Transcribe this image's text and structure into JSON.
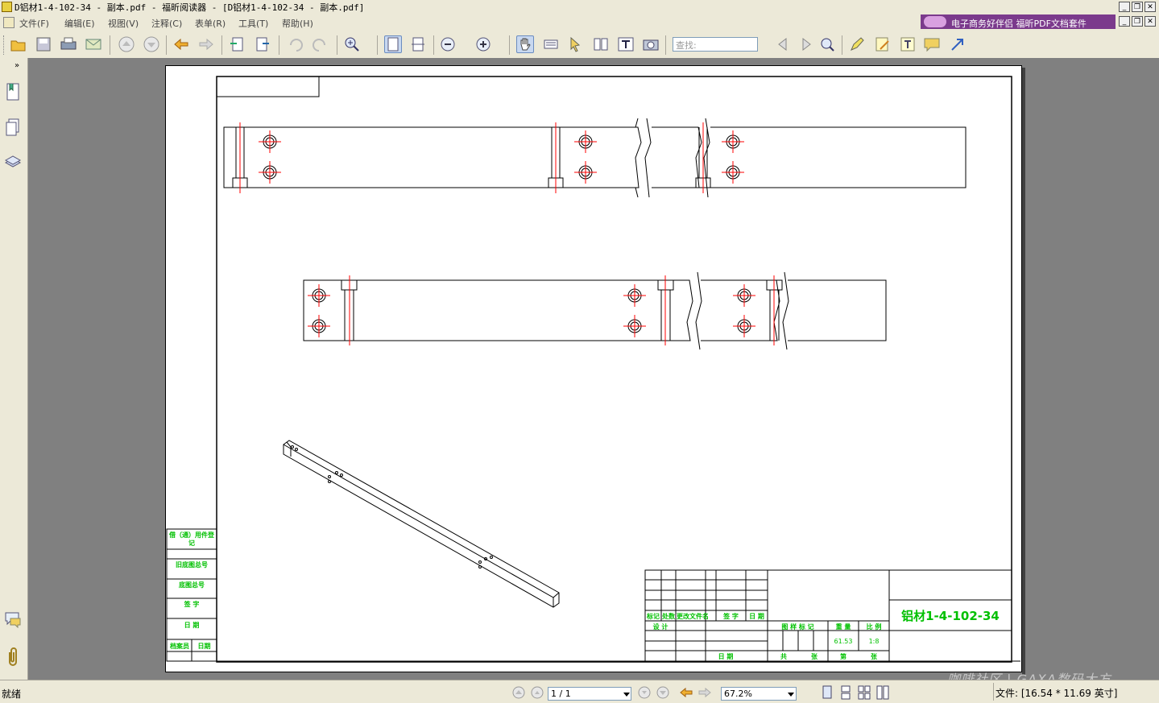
{
  "window": {
    "title": "D铝材1-4-102-34 - 副本.pdf - 福昕阅读器 - [D铝材1-4-102-34 - 副本.pdf]",
    "ad_text": "电子商务好伴侣  福昕PDF文档套件"
  },
  "menu": [
    "文件(F)",
    "编辑(E)",
    "视图(V)",
    "注释(C)",
    "表单(R)",
    "工具(T)",
    "帮助(H)"
  ],
  "toolbar": {
    "search_placeholder": "查找:"
  },
  "drawing": {
    "part_name": "铝材1-4-102-34",
    "title_block": {
      "mark": "标记",
      "count": "处数",
      "change_doc": "更改文件名",
      "signature": "签 字",
      "date": "日 期",
      "design": "设 计",
      "drawing_mark": "图 样 标 记",
      "weight_label": "重 量",
      "scale_label": "比 例",
      "weight": "61.53",
      "scale": "1:8",
      "total": "共",
      "sheets": "张",
      "sheet_no": "第",
      "sheet_unit": "张",
      "date2": "日 期"
    },
    "side_block": [
      "借（通）用件登记",
      "旧底图总号",
      "底图总号",
      "签 字",
      "日 期",
      "档案员",
      "日期"
    ]
  },
  "status": {
    "ready": "就绪",
    "page": "1 / 1",
    "zoom": "67.2%",
    "file_size": "文件: [16.54 * 11.69 英寸]",
    "watermark": "咖啡社区 | GAXA数码大方"
  },
  "colors": {
    "accent_ad": "#7b3a8c",
    "centerline": "#ff0000",
    "title_text": "#00c000"
  }
}
